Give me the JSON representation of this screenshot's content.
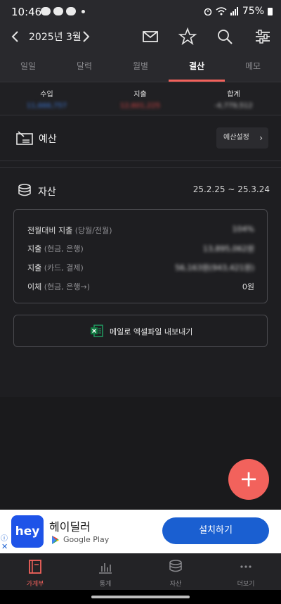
{
  "status_bar": {
    "time": "10:46",
    "battery": "75%"
  },
  "header": {
    "month": "2025년 3월"
  },
  "tabs": [
    {
      "label": "일일"
    },
    {
      "label": "달력"
    },
    {
      "label": "월별"
    },
    {
      "label": "결산",
      "active": true
    },
    {
      "label": "메모"
    }
  ],
  "summary": {
    "income_label": "수입",
    "income_value": "11,666,757",
    "expense_label": "지출",
    "expense_value": "12,601,225",
    "total_label": "합계",
    "total_value": "-4,779,512"
  },
  "budget": {
    "title": "예산",
    "settings_label": "예산설정"
  },
  "assets": {
    "title": "자산",
    "range": "25.2.25 ~ 25.3.24",
    "rows": [
      {
        "label": "전월대비 지출",
        "sub": "(당월/전월)",
        "value": "104%"
      },
      {
        "label": "지출",
        "sub": "(현금, 은행)",
        "value": "13,895,062원"
      },
      {
        "label": "지출",
        "sub": "(카드, 결제)",
        "value": "56,163원(943,421원)"
      },
      {
        "label": "이체",
        "sub": "(현금, 은행→)",
        "value": "0원"
      }
    ],
    "export_label": "메일로 엑셀파일 내보내기"
  },
  "ad": {
    "app_name": "헤이딜러",
    "logo_text": "hey",
    "store": "Google Play",
    "cta": "설치하기"
  },
  "bottom_nav": [
    {
      "label": "가계부",
      "active": true
    },
    {
      "label": "통계"
    },
    {
      "label": "자산"
    },
    {
      "label": "더보기"
    }
  ],
  "colors": {
    "accent": "#f2625c",
    "income": "#3f7de0",
    "expense": "#e04848",
    "ad_cta": "#1a5fd1"
  }
}
